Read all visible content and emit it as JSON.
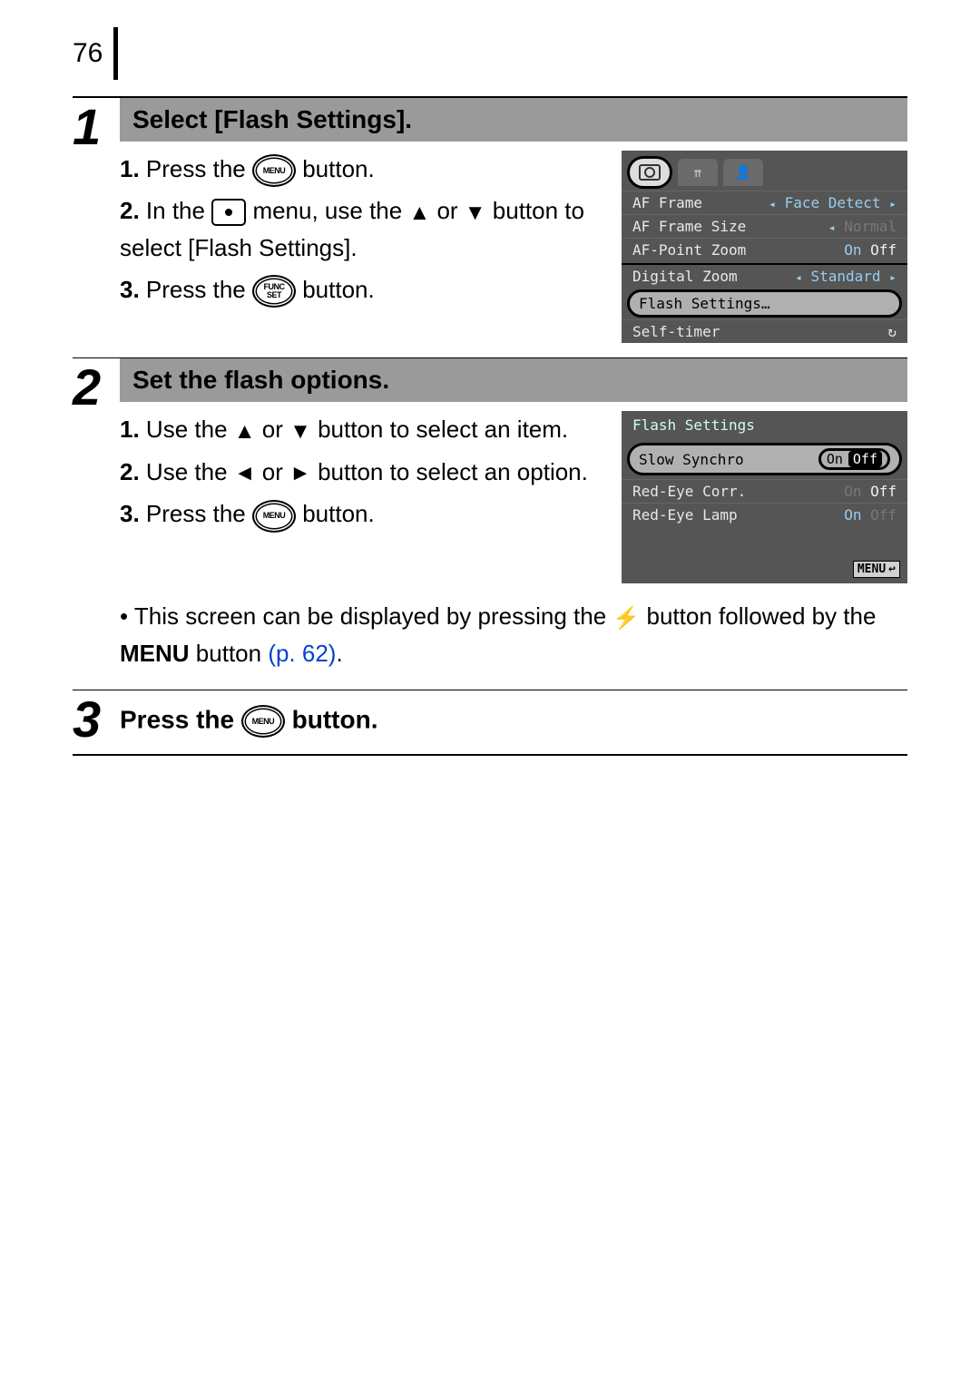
{
  "page_number": "76",
  "steps": [
    {
      "num": "1",
      "title": "Select [Flash Settings].",
      "substeps": [
        {
          "n": "1.",
          "before": "Press the ",
          "btn": "MENU",
          "after": " button."
        },
        {
          "n": "2.",
          "before": "In the ",
          "btn": "RECT",
          "after1": " menu, use the ",
          "arr1": "▲",
          "mid": " or ",
          "arr2": "▼",
          "after2": " button to select [Flash Settings]."
        },
        {
          "n": "3.",
          "before": "Press the ",
          "btn": "FUNCSET",
          "after": " button."
        }
      ]
    },
    {
      "num": "2",
      "title": "Set the flash options.",
      "substeps": [
        {
          "n": "1.",
          "before": "Use the ",
          "arr1": "▲",
          "mid": " or ",
          "arr2": "▼",
          "after": " button to select an item."
        },
        {
          "n": "2.",
          "before": "Use the ",
          "arr1": "◄",
          "mid": " or ",
          "arr2": "►",
          "after": " button to select an option."
        },
        {
          "n": "3.",
          "before": "Press the ",
          "btn": "MENU",
          "after": " button."
        }
      ],
      "note_before": "This screen can be displayed by pressing the ",
      "note_flash": "⚡",
      "note_mid": " button followed by the ",
      "note_bold": "MENU",
      "note_after": " button ",
      "note_link": "(p. 62)",
      "note_end": "."
    },
    {
      "num": "3",
      "title_before": "Press the ",
      "title_btn": "MENU",
      "title_after": " button."
    }
  ],
  "screen1": {
    "tabs": {
      "t2": "⇈",
      "t3": "👤"
    },
    "rows": [
      {
        "label": "AF Frame",
        "val_l": "◂",
        "val": "Face Detect",
        "val_r": "▸"
      },
      {
        "label": "AF Frame Size",
        "val_l": "◂",
        "val": "Normal",
        "dim": true
      },
      {
        "label": "AF-Point Zoom",
        "on": "On",
        "off": "Off"
      },
      {
        "label": "Digital Zoom",
        "val_l": "◂",
        "val": "Standard",
        "val_r": "▸",
        "sep": true
      }
    ],
    "highlight": "Flash Settings…",
    "last": {
      "label": "Self-timer",
      "icon": "↻"
    }
  },
  "screen2": {
    "title": "Flash Settings",
    "sel": {
      "label": "Slow Synchro",
      "on": "On",
      "off": "Off"
    },
    "rows": [
      {
        "label": "Red-Eye Corr.",
        "on": "On",
        "off": "Off",
        "on_dim": true
      },
      {
        "label": "Red-Eye Lamp",
        "on": "On",
        "off": "Off",
        "off_dim": true
      }
    ],
    "menu_return": "MENU",
    "return_icon": "↩"
  }
}
